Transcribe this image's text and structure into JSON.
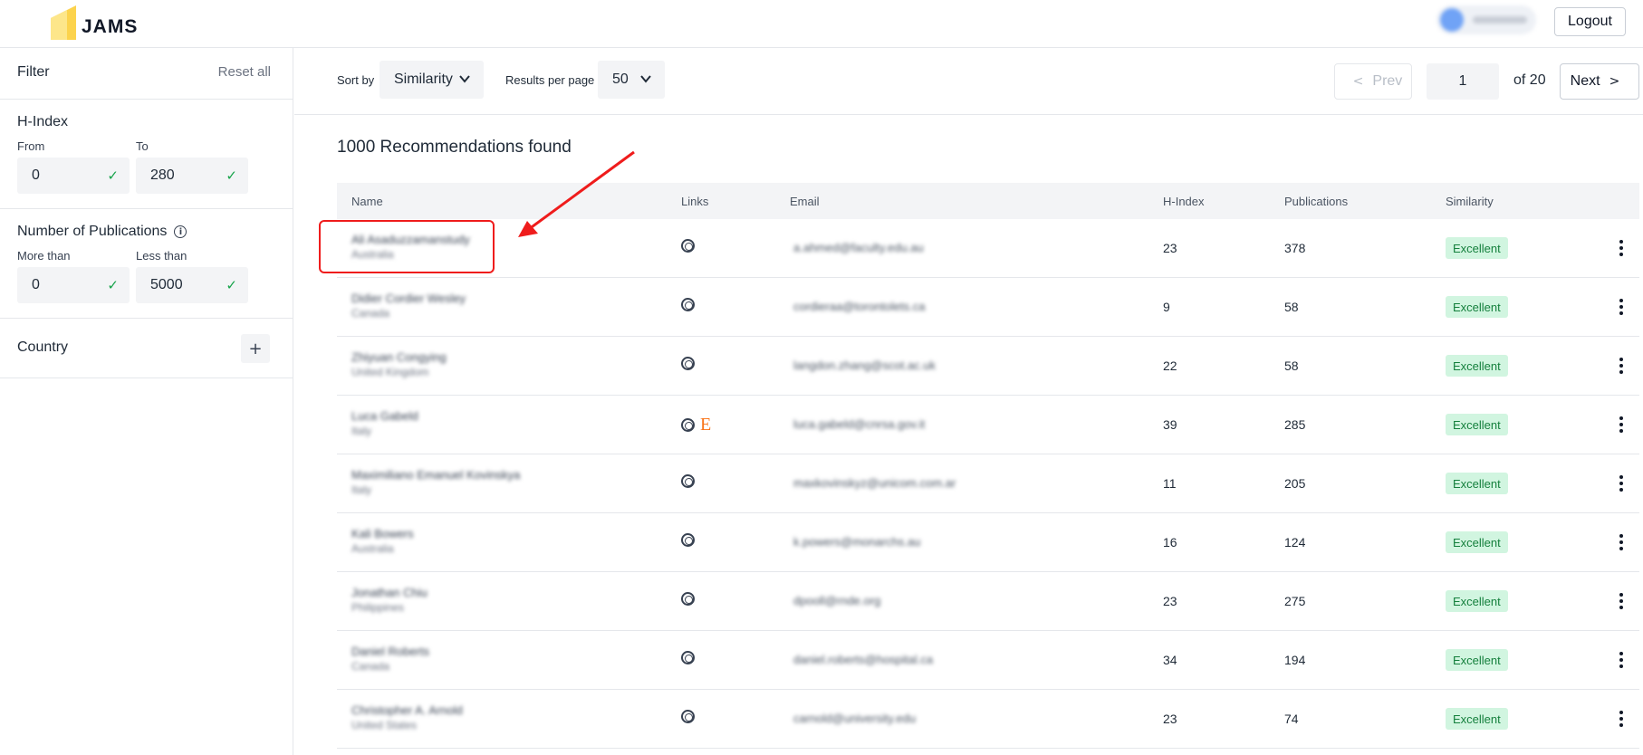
{
  "app": {
    "logo_text": "JAMS"
  },
  "header": {
    "logout_label": "Logout"
  },
  "sidebar": {
    "filter_title": "Filter",
    "reset_label": "Reset all",
    "hindex": {
      "title": "H-Index",
      "from_label": "From",
      "to_label": "To",
      "from_value": "0",
      "to_value": "280"
    },
    "publications": {
      "title": "Number of Publications",
      "more_label": "More than",
      "less_label": "Less than",
      "more_value": "0",
      "less_value": "5000"
    },
    "country": {
      "title": "Country"
    }
  },
  "toolbar": {
    "sort_label": "Sort by",
    "sort_value": "Similarity",
    "rpp_label": "Results per page",
    "rpp_value": "50",
    "prev_label": "Prev",
    "page_value": "1",
    "of_text": "of 20",
    "next_label": "Next"
  },
  "results": {
    "title": "1000 Recommendations found",
    "columns": {
      "name": "Name",
      "links": "Links",
      "email": "Email",
      "hindex": "H-Index",
      "publications": "Publications",
      "similarity": "Similarity"
    },
    "rows": [
      {
        "name": "Ali Asaduzzamanstudy",
        "country": "Australia",
        "email": "a.ahmed@faculty.edu.au",
        "hindex": "23",
        "publications": "378",
        "similarity": "Excellent"
      },
      {
        "name": "Didier Cordier Wesley",
        "country": "Canada",
        "email": "cordieraa@torontolets.ca",
        "hindex": "9",
        "publications": "58",
        "similarity": "Excellent"
      },
      {
        "name": "Zhiyuan Congying",
        "country": "United Kingdom",
        "email": "langdon.zhang@scot.ac.uk",
        "hindex": "22",
        "publications": "58",
        "similarity": "Excellent"
      },
      {
        "name": "Luca Gabeld",
        "country": "Italy",
        "email": "luca.gabeld@cnrsa.gov.it",
        "hindex": "39",
        "publications": "285",
        "similarity": "Excellent"
      },
      {
        "name": "Maximiliano Emanuel Kovinskya",
        "country": "Italy",
        "email": "maxkovinskyz@unicom.com.ar",
        "hindex": "11",
        "publications": "205",
        "similarity": "Excellent"
      },
      {
        "name": "Kali Bowers",
        "country": "Australia",
        "email": "k.powers@monarchs.au",
        "hindex": "16",
        "publications": "124",
        "similarity": "Excellent"
      },
      {
        "name": "Jonathan Chiu",
        "country": "Philippines",
        "email": "dpooll@rnde.org",
        "hindex": "23",
        "publications": "275",
        "similarity": "Excellent"
      },
      {
        "name": "Daniel Roberts",
        "country": "Canada",
        "email": "daniel.roberts@hospital.ca",
        "hindex": "34",
        "publications": "194",
        "similarity": "Excellent"
      },
      {
        "name": "Christopher A. Arnold",
        "country": "United States",
        "email": "carnold@university.edu",
        "hindex": "23",
        "publications": "74",
        "similarity": "Excellent"
      }
    ]
  },
  "colors": {
    "accent": "#fcd34d",
    "badge_bg": "#d1f5e0",
    "badge_text": "#15803d",
    "annotation": "#ef1c1c"
  },
  "icons": [
    "logo-icon",
    "check-icon",
    "info-icon",
    "plus-icon",
    "chevron-down-icon",
    "chevron-left-icon",
    "chevron-right-icon",
    "orcid-icon",
    "e-link-icon",
    "kebab-menu-icon",
    "annotation-arrow"
  ]
}
